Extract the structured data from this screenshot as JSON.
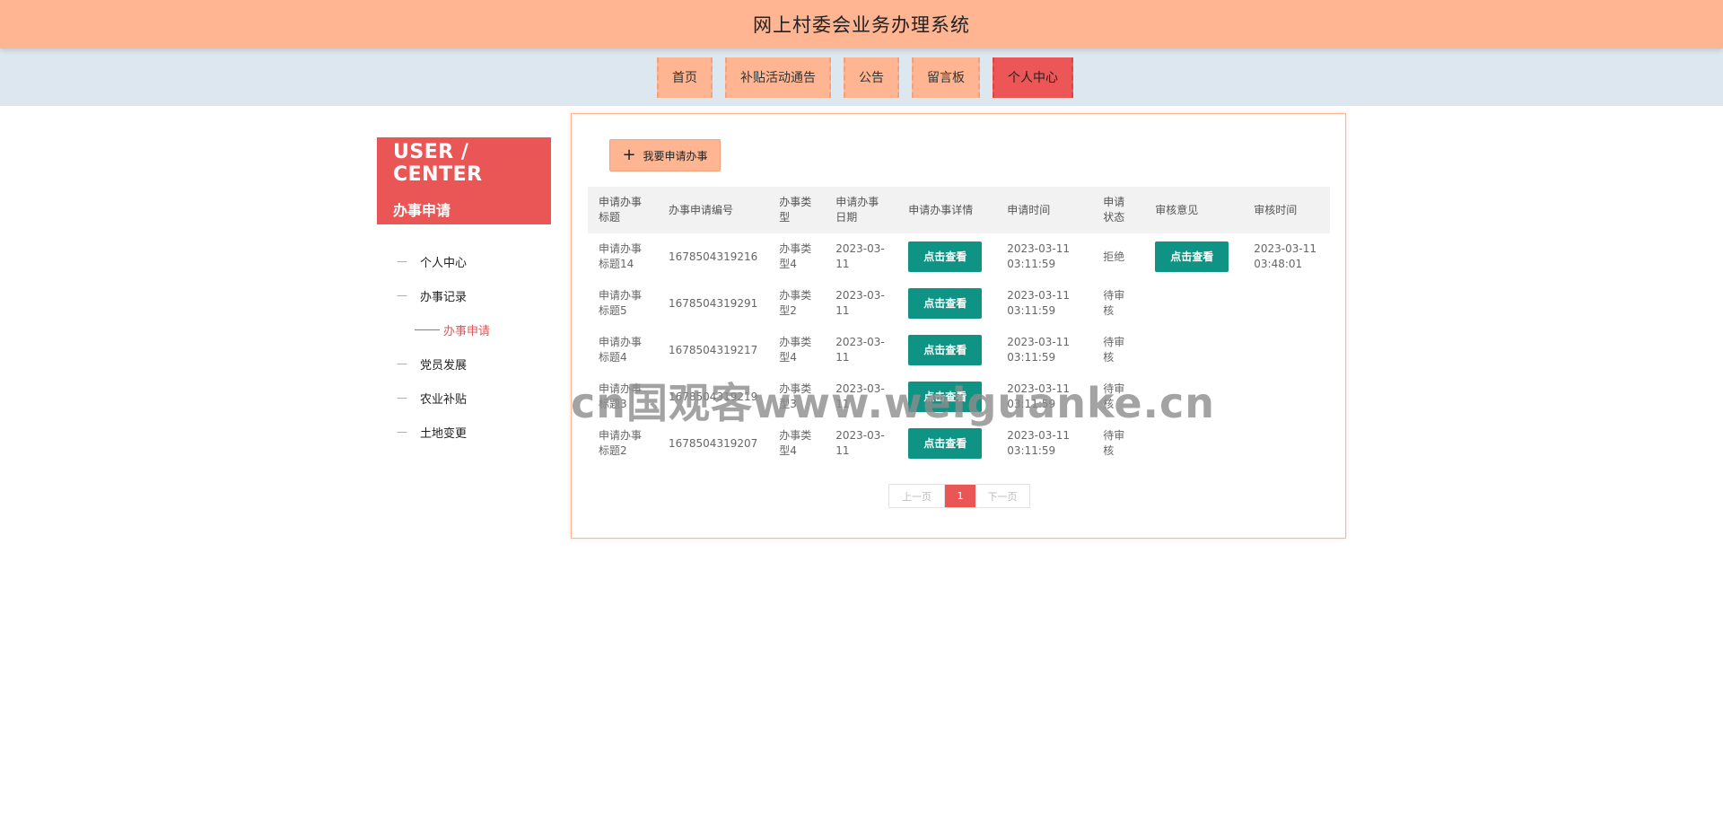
{
  "app": {
    "title": "网上村委会业务办理系统"
  },
  "nav": [
    {
      "label": "首页"
    },
    {
      "label": "补贴活动通告"
    },
    {
      "label": "公告"
    },
    {
      "label": "留言板"
    },
    {
      "label": "个人中心"
    }
  ],
  "sidebar": {
    "title_en": "USER / CENTER",
    "title_cn": "办事申请",
    "items": [
      {
        "label": "个人中心"
      },
      {
        "label": "办事记录"
      },
      {
        "label": "办事申请"
      },
      {
        "label": "党员发展"
      },
      {
        "label": "农业补贴"
      },
      {
        "label": "土地变更"
      }
    ]
  },
  "main": {
    "apply_button": "我要申请办事",
    "view_label": "点击查看",
    "columns": [
      "申请办事标题",
      "办事申请编号",
      "办事类型",
      "申请办事日期",
      "申请办事详情",
      "申请时间",
      "申请状态",
      "审核意见",
      "审核时间"
    ],
    "rows": [
      {
        "title": "申请办事标题14",
        "number": "1678504319216",
        "type": "办事类型4",
        "date": "2023-03-11",
        "apply_time": "2023-03-11 03:11:59",
        "status": "拒绝",
        "review_time": "2023-03-11 03:48:01"
      },
      {
        "title": "申请办事标题5",
        "number": "1678504319291",
        "type": "办事类型2",
        "date": "2023-03-11",
        "apply_time": "2023-03-11 03:11:59",
        "status": "待审核",
        "review_time": ""
      },
      {
        "title": "申请办事标题4",
        "number": "1678504319217",
        "type": "办事类型4",
        "date": "2023-03-11",
        "apply_time": "2023-03-11 03:11:59",
        "status": "待审核",
        "review_time": ""
      },
      {
        "title": "申请办事标题3",
        "number": "1678504319219",
        "type": "办事类型3",
        "date": "2023-03-11",
        "apply_time": "2023-03-11 03:11:59",
        "status": "待审核",
        "review_time": ""
      },
      {
        "title": "申请办事标题2",
        "number": "1678504319207",
        "type": "办事类型4",
        "date": "2023-03-11",
        "apply_time": "2023-03-11 03:11:59",
        "status": "待审核",
        "review_time": ""
      }
    ],
    "pager": {
      "prev": "上一页",
      "current": "1",
      "next": "下一页"
    }
  },
  "watermark": "cn国观客www.weiguanke.cn"
}
